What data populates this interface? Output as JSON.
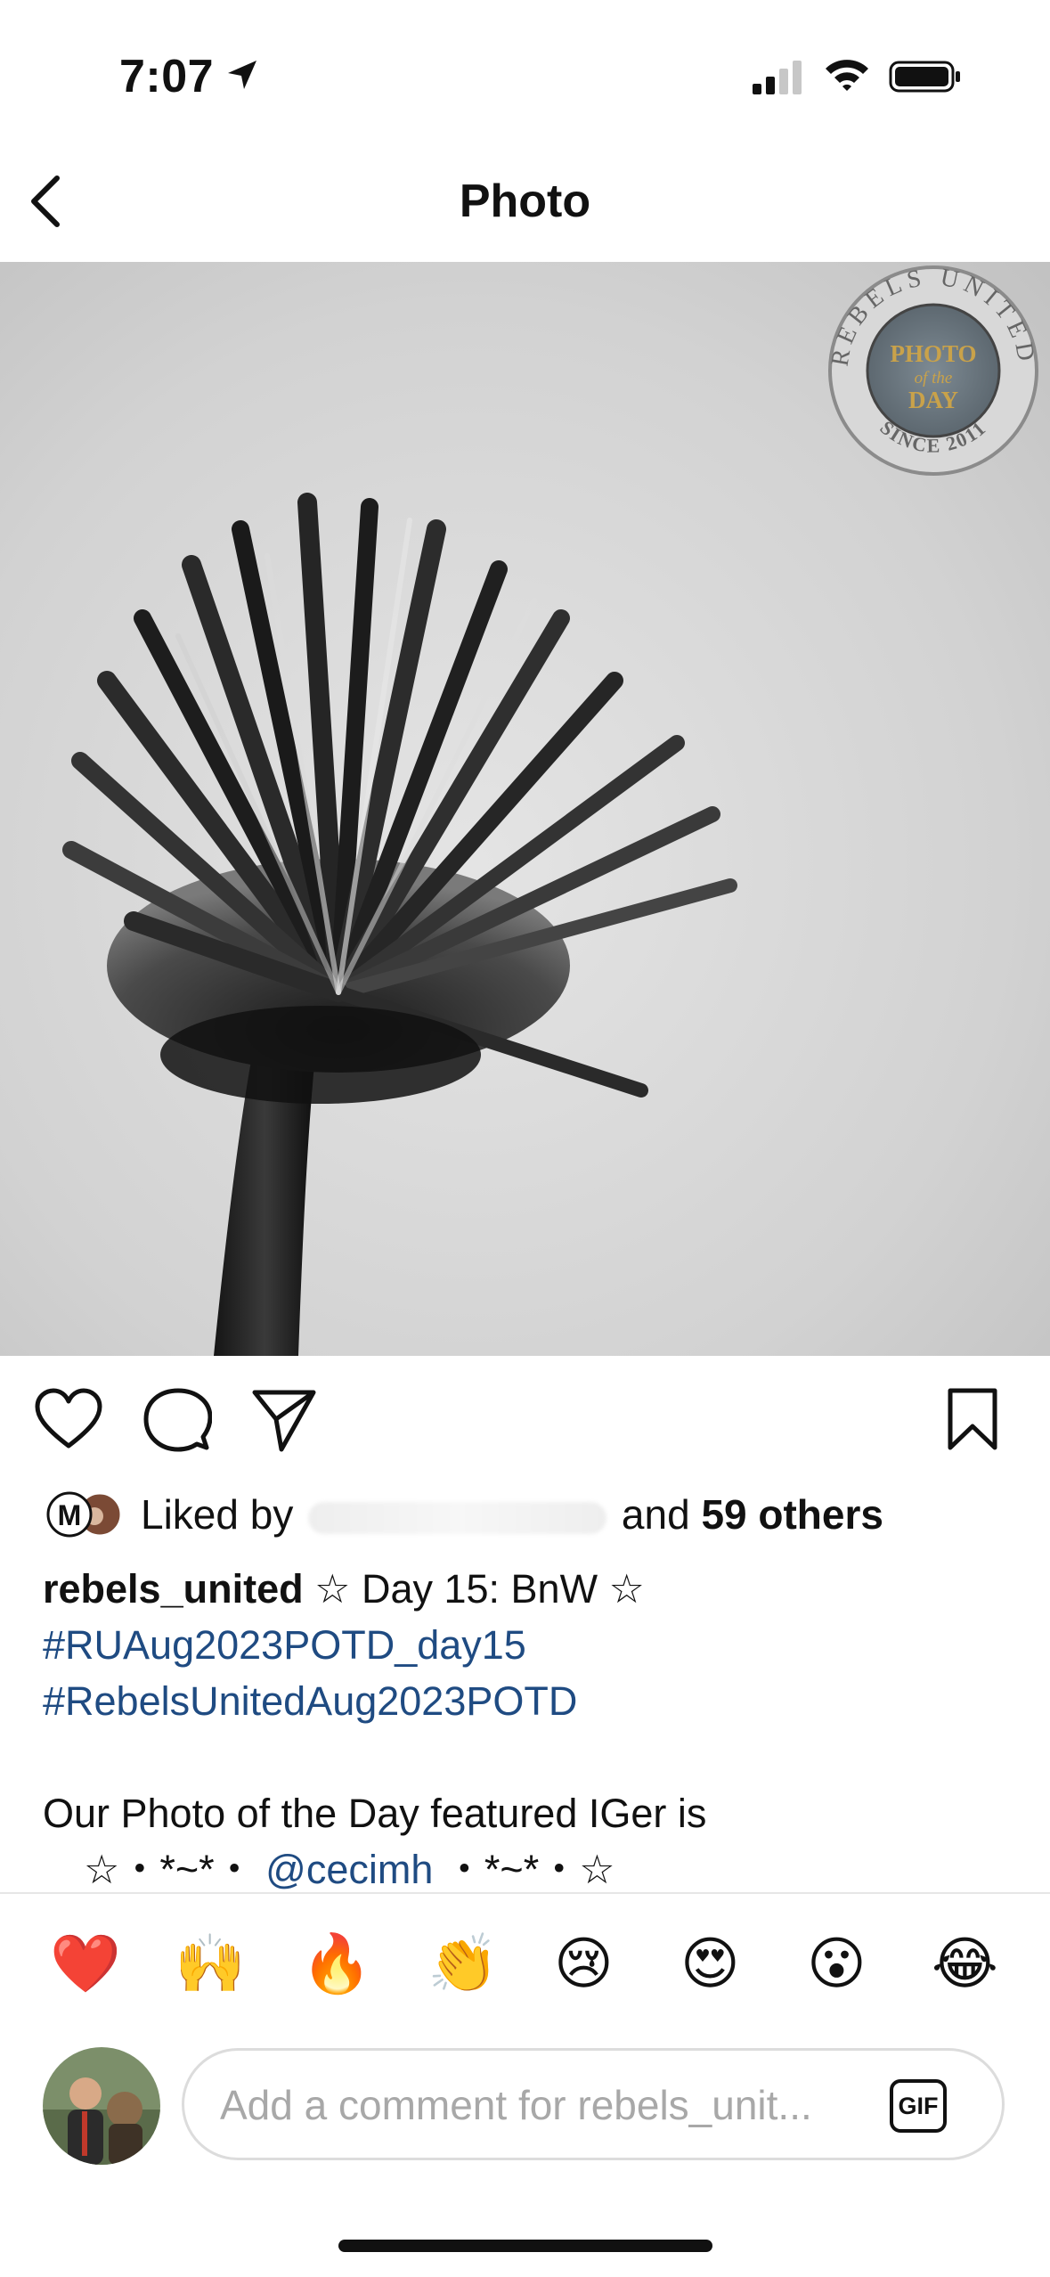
{
  "status_bar": {
    "time": "7:07",
    "location_icon": "location-arrow-icon",
    "signal_icon": "cellular-signal-icon",
    "wifi_icon": "wifi-icon",
    "battery_icon": "battery-icon"
  },
  "nav": {
    "title": "Photo",
    "back_icon": "chevron-left-icon"
  },
  "post": {
    "image_alt": "Black and white close-up of a wilted flower head",
    "badge": {
      "arc_top": "REBELS UNITED",
      "line1": "PHOTO",
      "line2": "of the",
      "line3": "DAY",
      "arc_bottom": "SINCE 2011"
    }
  },
  "actions": {
    "like_icon": "heart-icon",
    "comment_icon": "comment-bubble-icon",
    "share_icon": "paper-plane-icon",
    "save_icon": "bookmark-icon"
  },
  "likes": {
    "prefix": "Liked by",
    "conjunction": "and",
    "others": "59 others"
  },
  "caption": {
    "username": "rebels_united",
    "title": "☆ Day 15: BnW ☆",
    "hashtag1": "#RUAug2023POTD_day15",
    "hashtag2": "#RebelsUnitedAug2023POTD",
    "line1": "Our Photo of the Day featured IGer is",
    "deco_left": "☆・*~*・",
    "mention": "@cecimh",
    "deco_right": "・*~*・☆"
  },
  "reactions": [
    "❤️",
    "🙌",
    "🔥",
    "👏",
    "😢",
    "😍",
    "😮",
    "😂"
  ],
  "comment": {
    "placeholder": "Add a comment for rebels_unit...",
    "gif_label": "GIF"
  },
  "colors": {
    "hashtag": "#1f4b82",
    "badge_gold": "#c9a24a"
  }
}
